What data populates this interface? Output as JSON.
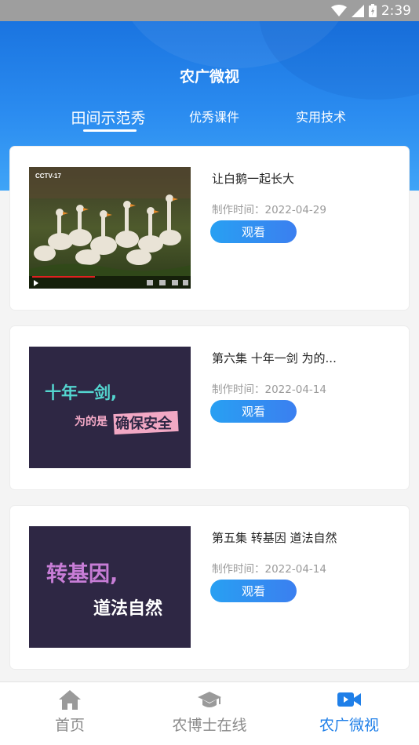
{
  "status_bar": {
    "time": "2:39"
  },
  "header": {
    "title": "农广微视"
  },
  "tabs": [
    {
      "label": "田间示范秀",
      "active": true
    },
    {
      "label": "优秀课件",
      "active": false
    },
    {
      "label": "实用技术",
      "active": false
    }
  ],
  "videos": [
    {
      "title": "让白鹅一起长大",
      "date": "制作时间：2022-04-29",
      "button": "观看",
      "thumbnail_channel": "CCTV-17"
    },
    {
      "title": "第六集 十年一剑 为的...",
      "date": "制作时间：2022-04-14",
      "button": "观看",
      "thumbnail_text": [
        "十年一剑,",
        "为的是",
        "确保安全"
      ]
    },
    {
      "title": "第五集 转基因 道法自然",
      "date": "制作时间：2022-04-14",
      "button": "观看",
      "thumbnail_text": [
        "转基因,",
        "道法自然"
      ]
    }
  ],
  "bottom_nav": [
    {
      "label": "首页",
      "icon": "home-icon",
      "active": false
    },
    {
      "label": "农博士在线",
      "icon": "graduation-cap-icon",
      "active": false
    },
    {
      "label": "农广微视",
      "icon": "video-camera-icon",
      "active": true
    }
  ],
  "colors": {
    "accent": "#1f7fe8",
    "header_top": "#1a74e0",
    "header_bottom": "#3fa4f7",
    "thumbnail_bg": "#2e2744"
  }
}
